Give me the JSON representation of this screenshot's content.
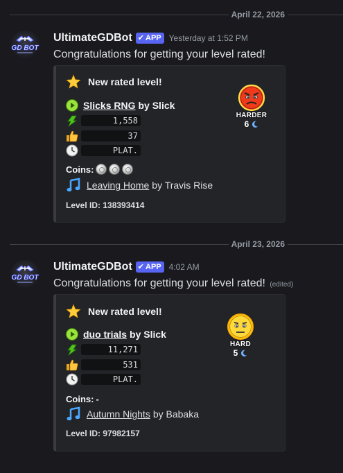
{
  "messages": [
    {
      "date_divider": "April 22, 2026",
      "username": "UltimateGDBot",
      "badge": "APP",
      "timestamp": "Yesterday at 1:52 PM",
      "content": "Congratulations for getting your level rated!",
      "edited": "",
      "avatar_text": "GD BOT",
      "embed": {
        "title": "New rated level!",
        "level_name": "Slicks RNG",
        "by": "by Slick",
        "downloads": "1,558",
        "likes": "37",
        "length": "PLAT.",
        "coins_label": "Coins:",
        "coins": 3,
        "coins_text": "",
        "song_name": "Leaving Home",
        "song_by": "by Travis Rise",
        "level_id": "Level ID: 138393414",
        "difficulty": "Harder",
        "stars": "6",
        "difficulty_color": "#e8301c"
      }
    },
    {
      "date_divider": "April 23, 2026",
      "username": "UltimateGDBot",
      "badge": "APP",
      "timestamp": "4:02 AM",
      "content": "Congratulations for getting your level rated!",
      "edited": "(edited)",
      "avatar_text": "GD BOT",
      "embed": {
        "title": "New rated level!",
        "level_name": "duo trials",
        "by": "by Slick",
        "downloads": "11,271",
        "likes": "531",
        "length": "PLAT.",
        "coins_label": "Coins:",
        "coins": 0,
        "coins_text": "-",
        "song_name": "Autumn Nights",
        "song_by": "by Babaka",
        "level_id": "Level ID: 97982157",
        "difficulty": "Hard",
        "stars": "5",
        "difficulty_color": "#f5c518"
      }
    }
  ],
  "colors": {
    "background": "#1a1a1e",
    "embed_bg": "#232428",
    "app_badge": "#5865f2",
    "code_bg": "#111214"
  }
}
